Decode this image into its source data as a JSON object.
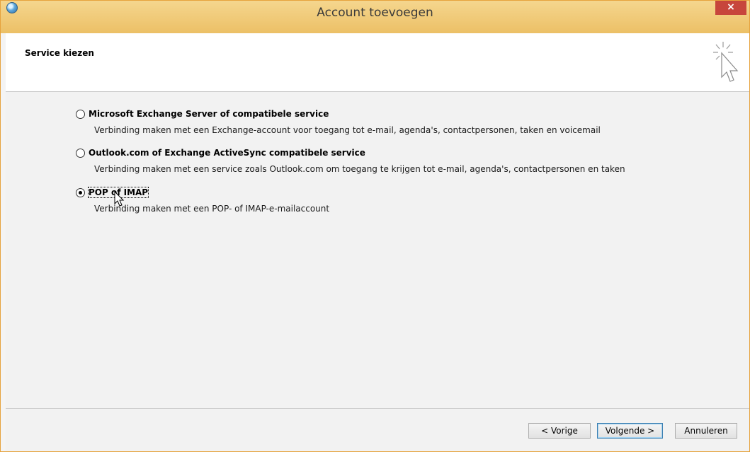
{
  "window": {
    "title": "Account toevoegen",
    "close_symbol": "×"
  },
  "header": {
    "title": "Service kiezen",
    "icon": "wizard-cursor-icon"
  },
  "options": [
    {
      "label": "Microsoft Exchange Server of compatibele service",
      "description": "Verbinding maken met een Exchange-account voor toegang tot e-mail, agenda's, contactpersonen, taken en voicemail",
      "selected": false
    },
    {
      "label": "Outlook.com of Exchange ActiveSync compatibele service",
      "description": "Verbinding maken met een service zoals Outlook.com om toegang te krijgen tot e-mail, agenda's, contactpersonen en taken",
      "selected": false
    },
    {
      "label": "POP of IMAP",
      "description": "Verbinding maken met een POP- of IMAP-e-mailaccount",
      "selected": true
    }
  ],
  "buttons": {
    "back": "< Vorige",
    "next": "Volgende >",
    "cancel": "Annuleren"
  },
  "colors": {
    "titlebar": "#f0c870",
    "close": "#c7463c",
    "default_button_border": "#3c7fb1"
  }
}
